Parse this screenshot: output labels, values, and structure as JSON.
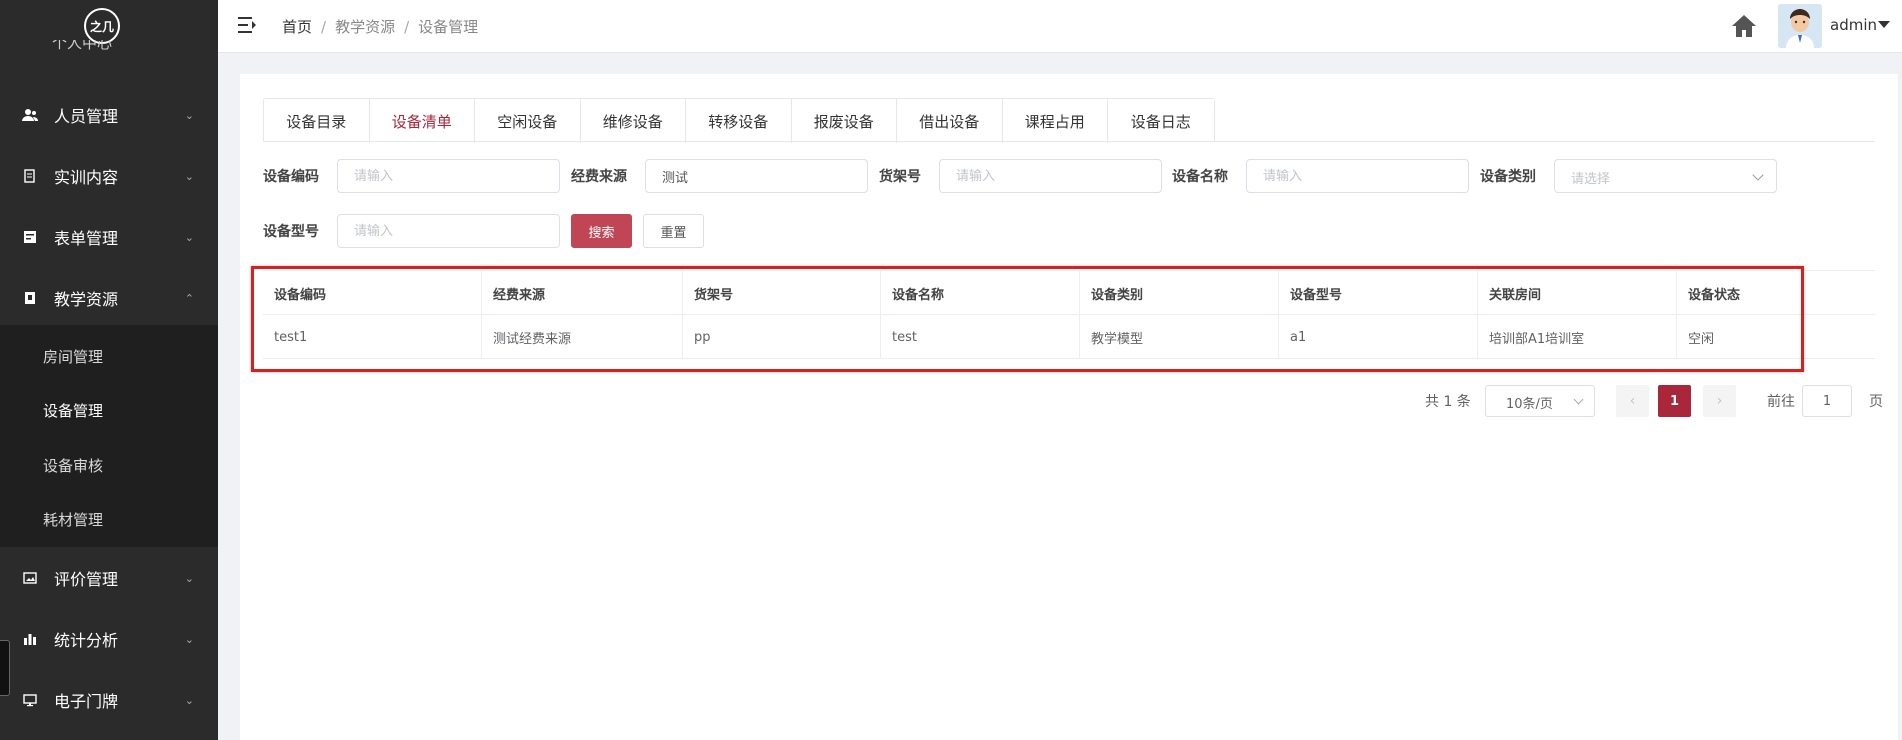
{
  "sidebar": {
    "logo": "之几",
    "partial_item": "个人中心",
    "items": [
      {
        "label": "人员管理",
        "icon": "users-icon"
      },
      {
        "label": "实训内容",
        "icon": "clipboard-icon"
      },
      {
        "label": "表单管理",
        "icon": "form-icon"
      },
      {
        "label": "教学资源",
        "icon": "book-icon"
      },
      {
        "label": "评价管理",
        "icon": "image-icon"
      },
      {
        "label": "统计分析",
        "icon": "bar-chart-icon"
      },
      {
        "label": "电子门牌",
        "icon": "monitor-icon"
      }
    ],
    "submenu": [
      {
        "label": "房间管理"
      },
      {
        "label": "设备管理"
      },
      {
        "label": "设备审核"
      },
      {
        "label": "耗材管理"
      }
    ]
  },
  "header": {
    "breadcrumb": [
      "首页",
      "教学资源",
      "设备管理"
    ],
    "separator": "/",
    "username": "admin"
  },
  "tabs": [
    "设备目录",
    "设备清单",
    "空闲设备",
    "维修设备",
    "转移设备",
    "报废设备",
    "借出设备",
    "课程占用",
    "设备日志"
  ],
  "filters": {
    "code_label": "设备编码",
    "code_placeholder": "请输入",
    "fund_label": "经费来源",
    "fund_value": "测试",
    "shelf_label": "货架号",
    "shelf_placeholder": "请输入",
    "name_label": "设备名称",
    "name_placeholder": "请输入",
    "category_label": "设备类别",
    "category_placeholder": "请选择",
    "model_label": "设备型号",
    "model_placeholder": "请输入",
    "search_btn": "搜索",
    "reset_btn": "重置"
  },
  "table": {
    "headers": [
      "设备编码",
      "经费来源",
      "货架号",
      "设备名称",
      "设备类别",
      "设备型号",
      "关联房间",
      "设备状态"
    ],
    "rows": [
      [
        "test1",
        "测试经费来源",
        "pp",
        "test",
        "教学模型",
        "a1",
        "培训部A1培训室",
        "空闲"
      ]
    ]
  },
  "pagination": {
    "total": "共 1 条",
    "page_size": "10条/页",
    "prev": "‹",
    "current": "1",
    "next": "›",
    "goto_prefix": "前往",
    "goto_value": "1",
    "goto_suffix": "页"
  },
  "colors": {
    "accent": "#a9263b",
    "sidebar_bg": "#2b2b2b",
    "highlight_border": "#d8201f"
  }
}
